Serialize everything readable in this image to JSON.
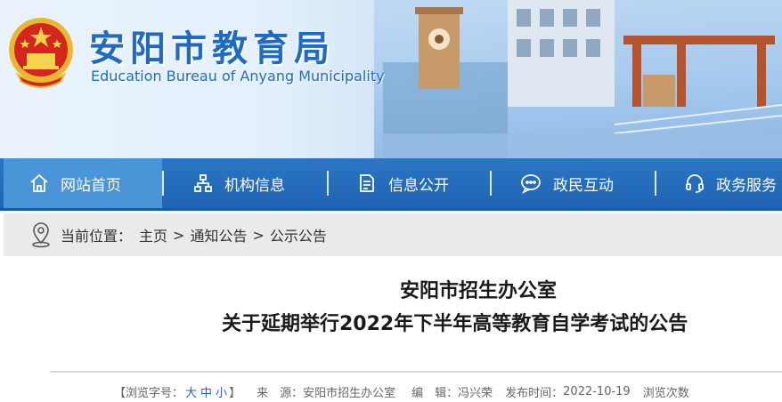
{
  "header": {
    "title_cn": "安阳市教育局",
    "title_en": "Education Bureau  of Anyang Municipality"
  },
  "nav": {
    "items": [
      {
        "label": "网站首页",
        "icon": "home-icon"
      },
      {
        "label": "机构信息",
        "icon": "org-structure-icon"
      },
      {
        "label": "信息公开",
        "icon": "document-icon"
      },
      {
        "label": "政民互动",
        "icon": "chat-icon"
      },
      {
        "label": "政务服务",
        "icon": "headset-icon"
      }
    ],
    "active_index": 0
  },
  "breadcrumb": {
    "prefix": "当前位置：",
    "items": [
      "主页",
      "通知公告",
      "公示公告"
    ],
    "separator": ">"
  },
  "article": {
    "title_line1": "安阳市招生办公室",
    "title_line2": "关于延期举行2022年下半年高等教育自学考试的公告",
    "meta": {
      "font_label": "【浏览字号：",
      "font_large": "大",
      "font_medium": "中",
      "font_small": "小",
      "font_close": "】",
      "source_label": "来　源：",
      "source": "安阳市招生办公室",
      "editor_label": "编　辑：",
      "editor": "冯兴荣",
      "date_label": "发布时间：",
      "date": "2022-10-19",
      "views_label": "浏览次数"
    }
  },
  "colors": {
    "nav_bg": "#1f64b2",
    "nav_active": "#4a94d8",
    "title_blue": "#1d6bc4",
    "breadcrumb_bg": "#eaeaea"
  }
}
